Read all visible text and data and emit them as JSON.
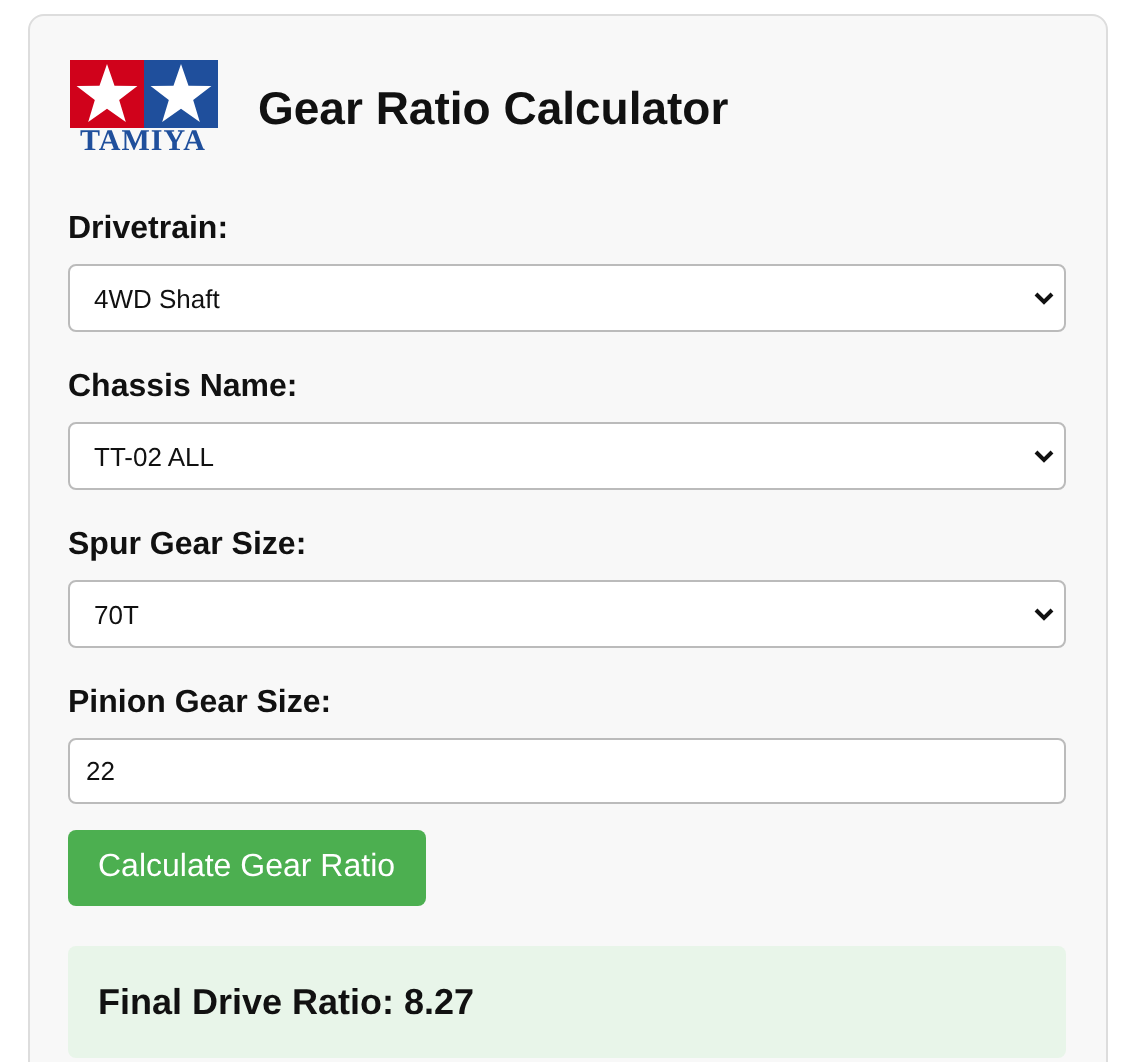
{
  "header": {
    "logo_text": "TAMIYA",
    "title": "Gear Ratio Calculator"
  },
  "fields": [
    {
      "kind": "select",
      "label": "Drivetrain:",
      "value": "4WD Shaft"
    },
    {
      "kind": "select",
      "label": "Chassis Name:",
      "value": "TT-02 ALL"
    },
    {
      "kind": "select",
      "label": "Spur Gear Size:",
      "value": "70T"
    },
    {
      "kind": "input",
      "label": "Pinion Gear Size:",
      "value": "22"
    }
  ],
  "button": "Calculate Gear Ratio",
  "result": "Final Drive Ratio: 8.27"
}
